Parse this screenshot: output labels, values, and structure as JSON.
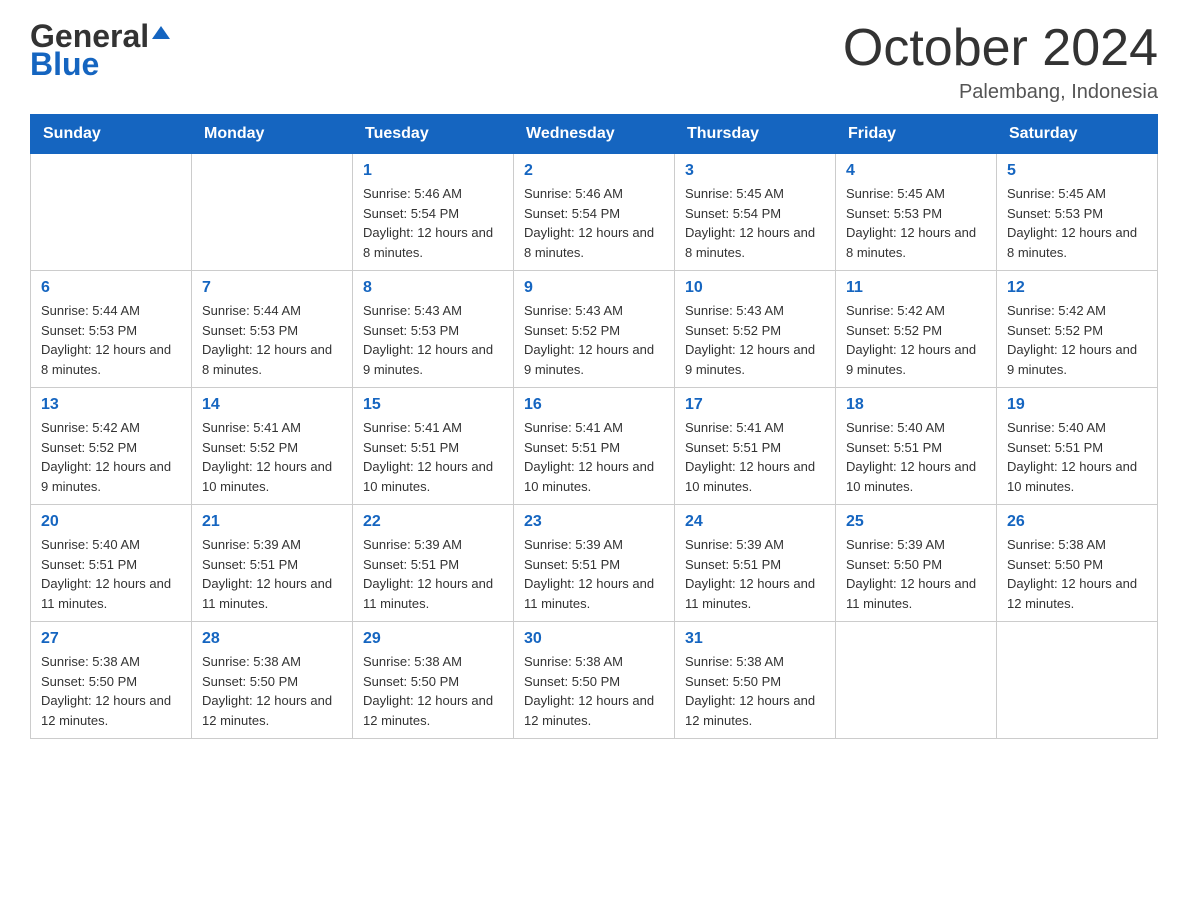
{
  "header": {
    "logo_general": "General",
    "logo_blue": "Blue",
    "month_title": "October 2024",
    "location": "Palembang, Indonesia"
  },
  "days_of_week": [
    "Sunday",
    "Monday",
    "Tuesday",
    "Wednesday",
    "Thursday",
    "Friday",
    "Saturday"
  ],
  "weeks": [
    [
      {
        "day": "",
        "sunrise": "",
        "sunset": "",
        "daylight": ""
      },
      {
        "day": "",
        "sunrise": "",
        "sunset": "",
        "daylight": ""
      },
      {
        "day": "1",
        "sunrise": "Sunrise: 5:46 AM",
        "sunset": "Sunset: 5:54 PM",
        "daylight": "Daylight: 12 hours and 8 minutes."
      },
      {
        "day": "2",
        "sunrise": "Sunrise: 5:46 AM",
        "sunset": "Sunset: 5:54 PM",
        "daylight": "Daylight: 12 hours and 8 minutes."
      },
      {
        "day": "3",
        "sunrise": "Sunrise: 5:45 AM",
        "sunset": "Sunset: 5:54 PM",
        "daylight": "Daylight: 12 hours and 8 minutes."
      },
      {
        "day": "4",
        "sunrise": "Sunrise: 5:45 AM",
        "sunset": "Sunset: 5:53 PM",
        "daylight": "Daylight: 12 hours and 8 minutes."
      },
      {
        "day": "5",
        "sunrise": "Sunrise: 5:45 AM",
        "sunset": "Sunset: 5:53 PM",
        "daylight": "Daylight: 12 hours and 8 minutes."
      }
    ],
    [
      {
        "day": "6",
        "sunrise": "Sunrise: 5:44 AM",
        "sunset": "Sunset: 5:53 PM",
        "daylight": "Daylight: 12 hours and 8 minutes."
      },
      {
        "day": "7",
        "sunrise": "Sunrise: 5:44 AM",
        "sunset": "Sunset: 5:53 PM",
        "daylight": "Daylight: 12 hours and 8 minutes."
      },
      {
        "day": "8",
        "sunrise": "Sunrise: 5:43 AM",
        "sunset": "Sunset: 5:53 PM",
        "daylight": "Daylight: 12 hours and 9 minutes."
      },
      {
        "day": "9",
        "sunrise": "Sunrise: 5:43 AM",
        "sunset": "Sunset: 5:52 PM",
        "daylight": "Daylight: 12 hours and 9 minutes."
      },
      {
        "day": "10",
        "sunrise": "Sunrise: 5:43 AM",
        "sunset": "Sunset: 5:52 PM",
        "daylight": "Daylight: 12 hours and 9 minutes."
      },
      {
        "day": "11",
        "sunrise": "Sunrise: 5:42 AM",
        "sunset": "Sunset: 5:52 PM",
        "daylight": "Daylight: 12 hours and 9 minutes."
      },
      {
        "day": "12",
        "sunrise": "Sunrise: 5:42 AM",
        "sunset": "Sunset: 5:52 PM",
        "daylight": "Daylight: 12 hours and 9 minutes."
      }
    ],
    [
      {
        "day": "13",
        "sunrise": "Sunrise: 5:42 AM",
        "sunset": "Sunset: 5:52 PM",
        "daylight": "Daylight: 12 hours and 9 minutes."
      },
      {
        "day": "14",
        "sunrise": "Sunrise: 5:41 AM",
        "sunset": "Sunset: 5:52 PM",
        "daylight": "Daylight: 12 hours and 10 minutes."
      },
      {
        "day": "15",
        "sunrise": "Sunrise: 5:41 AM",
        "sunset": "Sunset: 5:51 PM",
        "daylight": "Daylight: 12 hours and 10 minutes."
      },
      {
        "day": "16",
        "sunrise": "Sunrise: 5:41 AM",
        "sunset": "Sunset: 5:51 PM",
        "daylight": "Daylight: 12 hours and 10 minutes."
      },
      {
        "day": "17",
        "sunrise": "Sunrise: 5:41 AM",
        "sunset": "Sunset: 5:51 PM",
        "daylight": "Daylight: 12 hours and 10 minutes."
      },
      {
        "day": "18",
        "sunrise": "Sunrise: 5:40 AM",
        "sunset": "Sunset: 5:51 PM",
        "daylight": "Daylight: 12 hours and 10 minutes."
      },
      {
        "day": "19",
        "sunrise": "Sunrise: 5:40 AM",
        "sunset": "Sunset: 5:51 PM",
        "daylight": "Daylight: 12 hours and 10 minutes."
      }
    ],
    [
      {
        "day": "20",
        "sunrise": "Sunrise: 5:40 AM",
        "sunset": "Sunset: 5:51 PM",
        "daylight": "Daylight: 12 hours and 11 minutes."
      },
      {
        "day": "21",
        "sunrise": "Sunrise: 5:39 AM",
        "sunset": "Sunset: 5:51 PM",
        "daylight": "Daylight: 12 hours and 11 minutes."
      },
      {
        "day": "22",
        "sunrise": "Sunrise: 5:39 AM",
        "sunset": "Sunset: 5:51 PM",
        "daylight": "Daylight: 12 hours and 11 minutes."
      },
      {
        "day": "23",
        "sunrise": "Sunrise: 5:39 AM",
        "sunset": "Sunset: 5:51 PM",
        "daylight": "Daylight: 12 hours and 11 minutes."
      },
      {
        "day": "24",
        "sunrise": "Sunrise: 5:39 AM",
        "sunset": "Sunset: 5:51 PM",
        "daylight": "Daylight: 12 hours and 11 minutes."
      },
      {
        "day": "25",
        "sunrise": "Sunrise: 5:39 AM",
        "sunset": "Sunset: 5:50 PM",
        "daylight": "Daylight: 12 hours and 11 minutes."
      },
      {
        "day": "26",
        "sunrise": "Sunrise: 5:38 AM",
        "sunset": "Sunset: 5:50 PM",
        "daylight": "Daylight: 12 hours and 12 minutes."
      }
    ],
    [
      {
        "day": "27",
        "sunrise": "Sunrise: 5:38 AM",
        "sunset": "Sunset: 5:50 PM",
        "daylight": "Daylight: 12 hours and 12 minutes."
      },
      {
        "day": "28",
        "sunrise": "Sunrise: 5:38 AM",
        "sunset": "Sunset: 5:50 PM",
        "daylight": "Daylight: 12 hours and 12 minutes."
      },
      {
        "day": "29",
        "sunrise": "Sunrise: 5:38 AM",
        "sunset": "Sunset: 5:50 PM",
        "daylight": "Daylight: 12 hours and 12 minutes."
      },
      {
        "day": "30",
        "sunrise": "Sunrise: 5:38 AM",
        "sunset": "Sunset: 5:50 PM",
        "daylight": "Daylight: 12 hours and 12 minutes."
      },
      {
        "day": "31",
        "sunrise": "Sunrise: 5:38 AM",
        "sunset": "Sunset: 5:50 PM",
        "daylight": "Daylight: 12 hours and 12 minutes."
      },
      {
        "day": "",
        "sunrise": "",
        "sunset": "",
        "daylight": ""
      },
      {
        "day": "",
        "sunrise": "",
        "sunset": "",
        "daylight": ""
      }
    ]
  ]
}
